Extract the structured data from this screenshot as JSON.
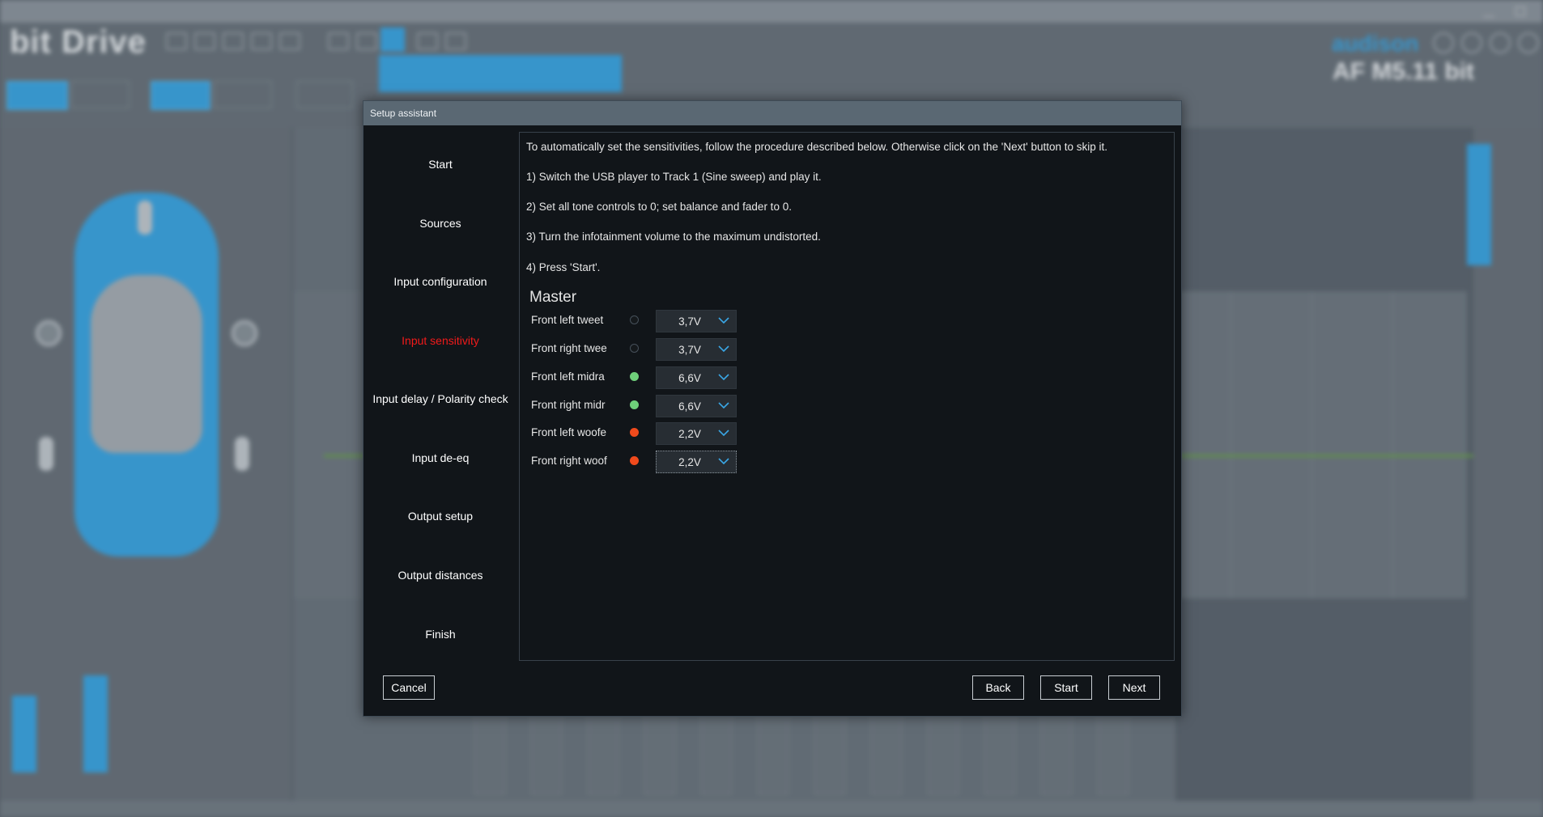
{
  "dialog": {
    "title": "Setup assistant",
    "steps": [
      {
        "label": "Start",
        "active": false
      },
      {
        "label": "Sources",
        "active": false
      },
      {
        "label": "Input configuration",
        "active": false
      },
      {
        "label": "Input sensitivity",
        "active": true
      },
      {
        "label": "Input delay / Polarity check",
        "active": false
      },
      {
        "label": "Input de-eq",
        "active": false
      },
      {
        "label": "Output setup",
        "active": false
      },
      {
        "label": "Output distances",
        "active": false
      },
      {
        "label": "Finish",
        "active": false
      }
    ],
    "instructions": [
      "To automatically set the sensitivities, follow the procedure described below. Otherwise click on the 'Next' button to skip it.",
      "1) Switch the USB player to Track 1 (Sine sweep) and play it.",
      "2) Set all tone controls to 0; set balance and fader to 0.",
      "3) Turn the infotainment volume to the maximum undistorted.",
      "4) Press 'Start'."
    ],
    "section_title": "Master",
    "channels": [
      {
        "label": "Front left tweet",
        "led": "off",
        "value": "3,7V"
      },
      {
        "label": "Front right twee",
        "led": "off",
        "value": "3,7V"
      },
      {
        "label": "Front left midra",
        "led": "green",
        "value": "6,6V"
      },
      {
        "label": "Front right midr",
        "led": "green",
        "value": "6,6V"
      },
      {
        "label": "Front left woofe",
        "led": "red",
        "value": "2,2V"
      },
      {
        "label": "Front right woof",
        "led": "red",
        "value": "2,2V"
      }
    ],
    "buttons": {
      "cancel": "Cancel",
      "back": "Back",
      "start": "Start",
      "next": "Next"
    }
  },
  "colors": {
    "accent": "#3aa7e6",
    "active_step": "#f21a1a",
    "led_green": "#6fd07a",
    "led_red": "#f04a1c",
    "dialog_bg": "#111519"
  }
}
